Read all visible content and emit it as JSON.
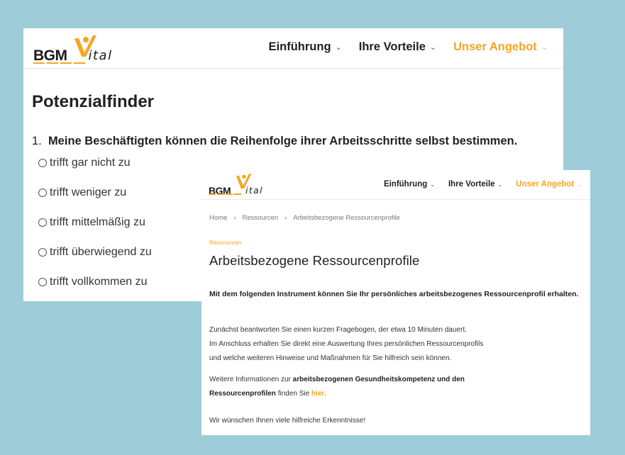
{
  "brand": {
    "logo_left": "BGM",
    "logo_right": "ital",
    "accent_color": "#f5a623"
  },
  "nav": {
    "items": [
      {
        "label": "Einführung",
        "icon": "chevron-down-icon",
        "active": false
      },
      {
        "label": "Ihre Vorteile",
        "icon": "chevron-down-icon",
        "active": false
      },
      {
        "label": "Unser Angebot",
        "icon": "chevron-down-icon",
        "active": true
      }
    ],
    "chevron": "⌄"
  },
  "back_page": {
    "title": "Potenzialfinder",
    "question_number": "1.",
    "question_text": "Meine Beschäftigten können die Reihenfolge ihrer Arbeitsschritte selbst bestimmen.",
    "options": [
      "trifft gar nicht zu",
      "trifft weniger zu",
      "trifft mittelmäßig zu",
      "trifft überwiegend zu",
      "trifft vollkommen zu"
    ]
  },
  "front_page": {
    "breadcrumb": {
      "home": "Home",
      "sep": "›",
      "level1": "Ressourcen",
      "level2": "Arbeitsbezogene Ressourcenprofile"
    },
    "section_tag": "Ressourcen",
    "title": "Arbeitsbezogene Ressourcenprofile",
    "intro": "Mit dem folgenden Instrument können Sie Ihr persönliches arbeitsbezogenes Ressourcenprofil erhalten.",
    "para1_line1": "Zunächst beantworten Sie einen kurzen Fragebogen, der etwa 10 Minuten dauert.",
    "para1_line2": "Im Anschluss erhalten Sie direkt eine Auswertung Ihres persönlichen Ressourcenprofils",
    "para1_line3": "und welche weiteren Hinweise und Maßnahmen für Sie hilfreich sein können.",
    "para2_pre": "Weitere Informationen zur ",
    "para2_bold1": "arbeitsbezogenen Gesundheitskompetenz und den",
    "para2_bold2": "Ressourcenprofilen",
    "para2_mid": " finden Sie ",
    "para2_link": "hier",
    "para2_end": ".",
    "para3": "Wir wünschen Ihnen viele hilfreiche Erkenntnisse!"
  }
}
